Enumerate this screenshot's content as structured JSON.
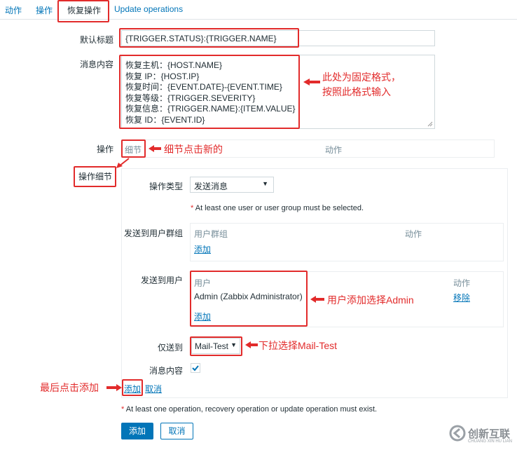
{
  "tabs": [
    {
      "label": "动作"
    },
    {
      "label": "操作"
    },
    {
      "label": "恢复操作"
    },
    {
      "label": "Update operations"
    }
  ],
  "form": {
    "default_subject_label": "默认标题",
    "default_subject_value": "{TRIGGER.STATUS}:{TRIGGER.NAME}",
    "message_label": "消息内容",
    "message_lines": [
      "恢复主机：{HOST.NAME}",
      "恢复 IP：{HOST.IP}",
      "恢复时间：{EVENT.DATE}-{EVENT.TIME}",
      "恢复等级：{TRIGGER.SEVERITY}",
      "恢复信息：{TRIGGER.NAME}:{ITEM.VALUE}",
      "恢复 ID：{EVENT.ID}"
    ],
    "operations_label": "操作",
    "operations_detail_col": "细节",
    "operations_action_col": "动作",
    "operation_details_label": "操作细节"
  },
  "details": {
    "op_type_label": "操作类型",
    "op_type_value": "发送消息",
    "warning_user": "At least one user or user group must be selected.",
    "send_groups_label": "发送到用户群组",
    "groups_col_group": "用户群组",
    "groups_col_action": "动作",
    "groups_add": "添加",
    "send_users_label": "发送到用户",
    "users_col_user": "用户",
    "users_col_action": "动作",
    "user_row_name": "Admin (Zabbix Administrator)",
    "user_row_remove": "移除",
    "users_add": "添加",
    "send_only_label": "仅送到",
    "send_only_value": "Mail-Test",
    "message_content_label": "消息内容",
    "add_link": "添加",
    "cancel_link": "取消"
  },
  "footer": {
    "warning": "At least one operation, recovery operation or update operation must exist.",
    "add_button": "添加",
    "cancel_button": "取消"
  },
  "annotations": {
    "fixed_format": "此处为固定格式，",
    "fixed_format_2": "按照此格式输入",
    "detail_click_new": "细节点击新的",
    "user_add_admin": "用户添加选择Admin",
    "dropdown_mail": "下拉选择Mail-Test",
    "last_click_add": "最后点击添加"
  },
  "watermark": {
    "text": "创新互联",
    "subtext": "CHUANG XIN HU LIAN"
  },
  "colors": {
    "accent": "#0275b8",
    "annotation_red": "#e22b2b",
    "checkbox_blue": "#0275b8"
  }
}
